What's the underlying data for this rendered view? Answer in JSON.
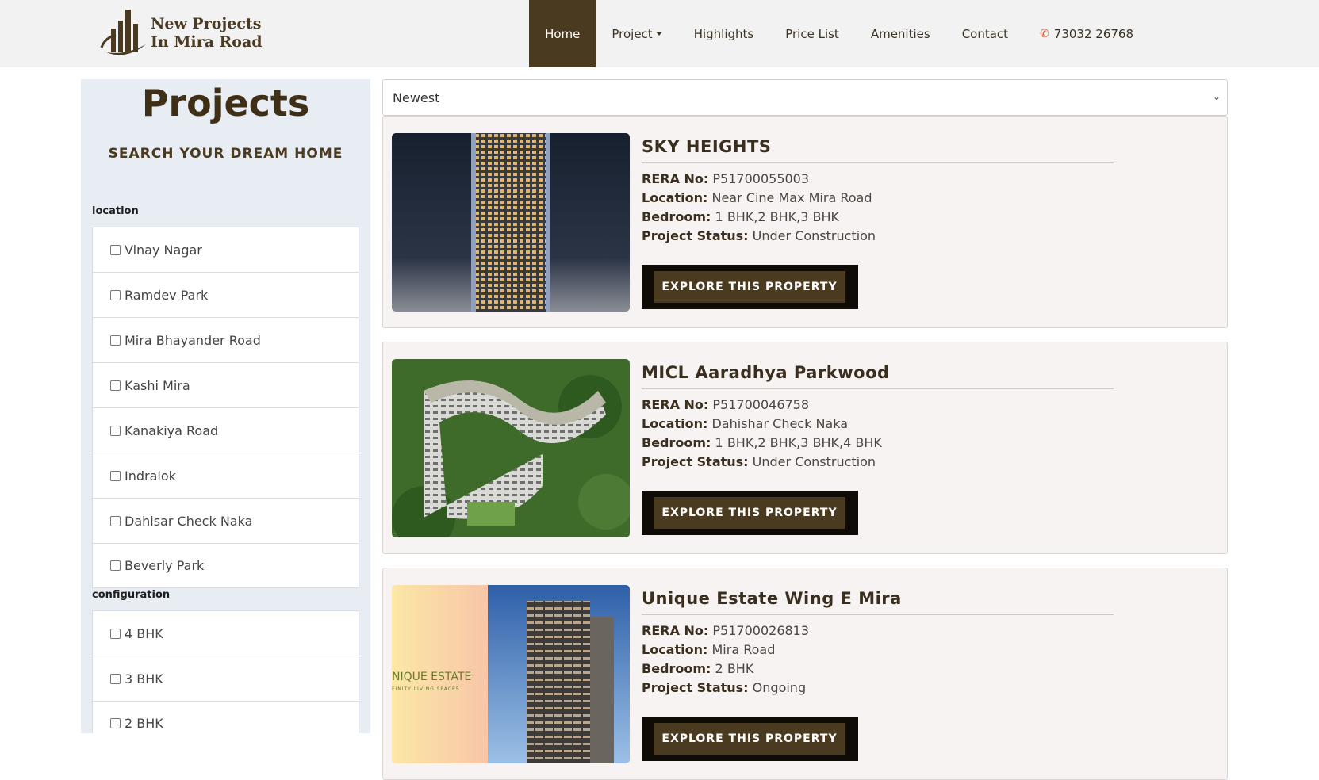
{
  "header": {
    "logo_line1": "New Projects",
    "logo_line2": "In Mira Road",
    "nav": {
      "home": "Home",
      "project": "Project",
      "highlights": "Highlights",
      "price_list": "Price List",
      "amenities": "Amenities",
      "contact": "Contact",
      "phone": "73032 26768"
    }
  },
  "sidebar": {
    "title": "Projects",
    "subtitle": "SEARCH YOUR DREAM HOME",
    "location_label": "location",
    "locations": [
      "Vinay Nagar",
      "Ramdev Park",
      "Mira Bhayander Road",
      "Kashi Mira",
      "Kanakiya Road",
      "Indralok",
      "Dahisar Check Naka",
      "Beverly Park"
    ],
    "configuration_label": "configuration",
    "configurations": [
      "4 BHK",
      "3 BHK",
      "2 BHK"
    ]
  },
  "sort": {
    "selected": "Newest"
  },
  "labels": {
    "rera": "RERA No:",
    "location": "Location:",
    "bedroom": "Bedroom:",
    "status": "Project Status:",
    "explore": "EXPLORE THIS PROPERTY"
  },
  "projects": [
    {
      "name": "SKY HEIGHTS",
      "rera": "P51700055003",
      "location": "Near Cine Max Mira Road",
      "bedroom": "1 BHK,2 BHK,3 BHK",
      "status": "Under Construction"
    },
    {
      "name": "MICL Aaradhya Parkwood",
      "rera": "P51700046758",
      "location": "Dahishar Check Naka",
      "bedroom": "1 BHK,2 BHK,3 BHK,4 BHK",
      "status": "Under Construction"
    },
    {
      "name": "Unique Estate Wing E Mira",
      "rera": "P51700026813",
      "location": "Mira Road",
      "bedroom": "2 BHK",
      "status": "Ongoing",
      "img_brand": "NIQUE ESTATE",
      "img_tagline": "FINITY LIVING SPACES"
    }
  ],
  "colors": {
    "brand_brown": "#4a3a20",
    "sidebar_bg": "#e7edf3",
    "card_bg": "#f7f3f2",
    "phone_icon": "#e4572e"
  }
}
